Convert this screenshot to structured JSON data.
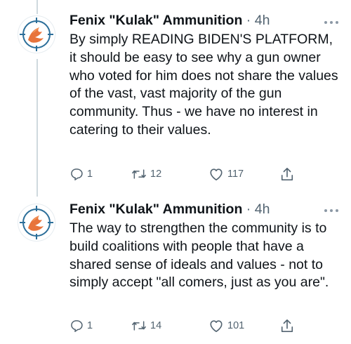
{
  "tweets": [
    {
      "author": "Fenix \"Kulak\" Ammunition",
      "separator": "·",
      "time": "4h",
      "text": "By simply READING BIDEN'S PLATFORM, it should be easy to see why a gun owner who voted for him does not share the values of the vast, vast majority of the gun community. Thus - we have no interest in catering to their values.",
      "replies": "1",
      "retweets": "12",
      "likes": "117"
    },
    {
      "author": "Fenix \"Kulak\" Ammunition",
      "separator": "·",
      "time": "4h",
      "text": "The way to strengthen the community is to build coalitions with people that have a shared sense of ideals and values - not to simply accept \"all comers, just as you are\".",
      "replies": "1",
      "retweets": "14",
      "likes": "101"
    }
  ],
  "colors": {
    "text": "#0f1419",
    "secondary": "#536471",
    "avatar_ring": "#2b6e99",
    "avatar_logo": "#e8743b",
    "thread_line": "#cfd9de"
  },
  "icons": {
    "reply": "reply-icon",
    "retweet": "retweet-icon",
    "like": "heart-icon",
    "share": "share-icon",
    "more": "more-icon",
    "avatar_logo": "phoenix-logo"
  }
}
